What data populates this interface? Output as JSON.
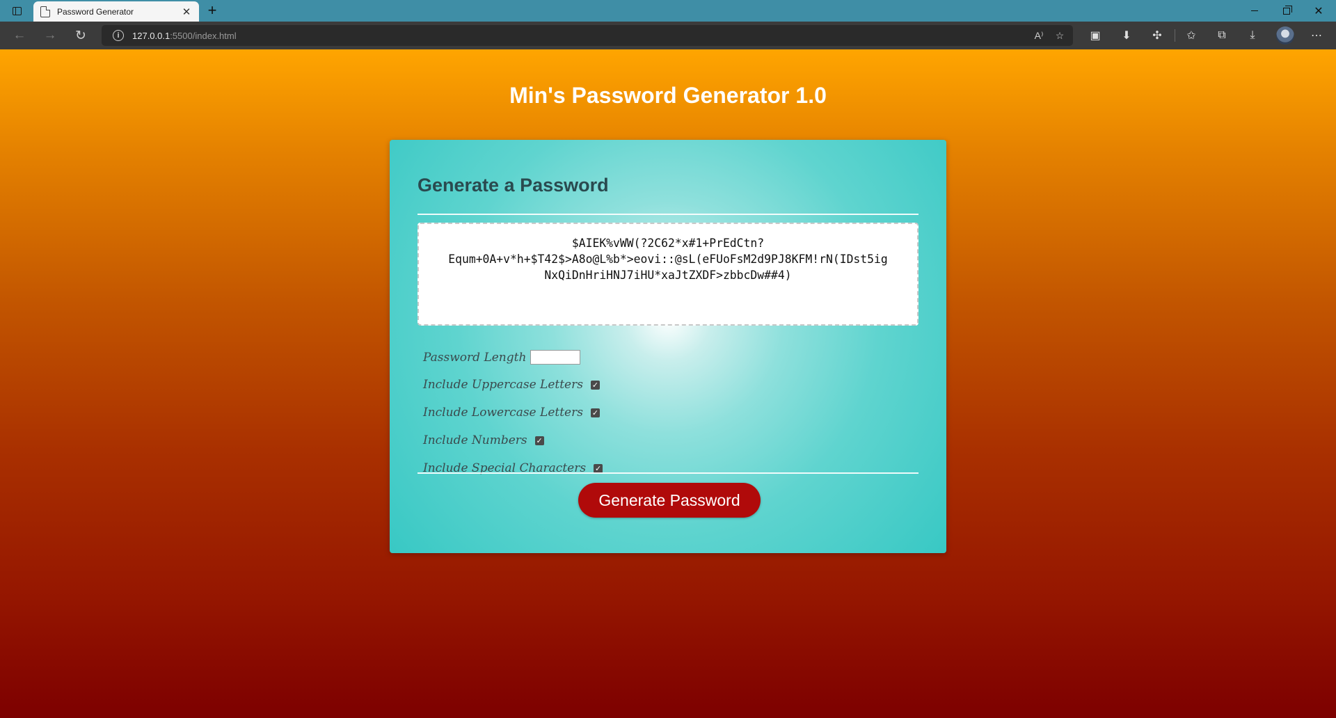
{
  "browser": {
    "tab_title": "Password Generator",
    "tab_close": "✕",
    "new_tab": "+",
    "url_host": "127.0.0.1",
    "url_path": ":5500/index.html",
    "window_controls": {
      "close": "✕"
    }
  },
  "page": {
    "title": "Min's Password Generator 1.0"
  },
  "card": {
    "header": "Generate a Password",
    "password_lines": [
      "$AIEK%vWW(?2C62*x#1+PrEdCtn?",
      "Equm+0A+v*h+$T42$>A8o@L%b*>eovi::@sL(eFUoFsM2d9PJ8KFM!rN(IDst5ig",
      "NxQiDnHriHNJ7iHU*xaJtZXDF>zbbcDw##4)"
    ],
    "options": {
      "length_label": "Password Length",
      "length_value": "",
      "uppercase_label": "Include Uppercase Letters",
      "uppercase_checked": true,
      "lowercase_label": "Include Lowercase Letters",
      "lowercase_checked": true,
      "numbers_label": "Include Numbers",
      "numbers_checked": true,
      "special_label": "Include Special Characters",
      "special_checked": true
    },
    "button_label": "Generate Password"
  },
  "colors": {
    "button": "#b00a0a",
    "card_accent": "#38c8c4",
    "bg_top": "#ffa500",
    "bg_bottom": "#7d0000"
  },
  "icons": {
    "back": "back-arrow-icon",
    "forward": "forward-arrow-icon",
    "refresh": "refresh-icon",
    "info": "site-info-icon",
    "read_aloud": "read-aloud-icon",
    "add_favorite": "add-favorite-icon",
    "collections": "collections-icon",
    "downloads": "download-icon",
    "extensions": "extensions-icon",
    "favorites": "favorites-icon",
    "profile": "profile-avatar",
    "more": "more-menu-icon"
  }
}
